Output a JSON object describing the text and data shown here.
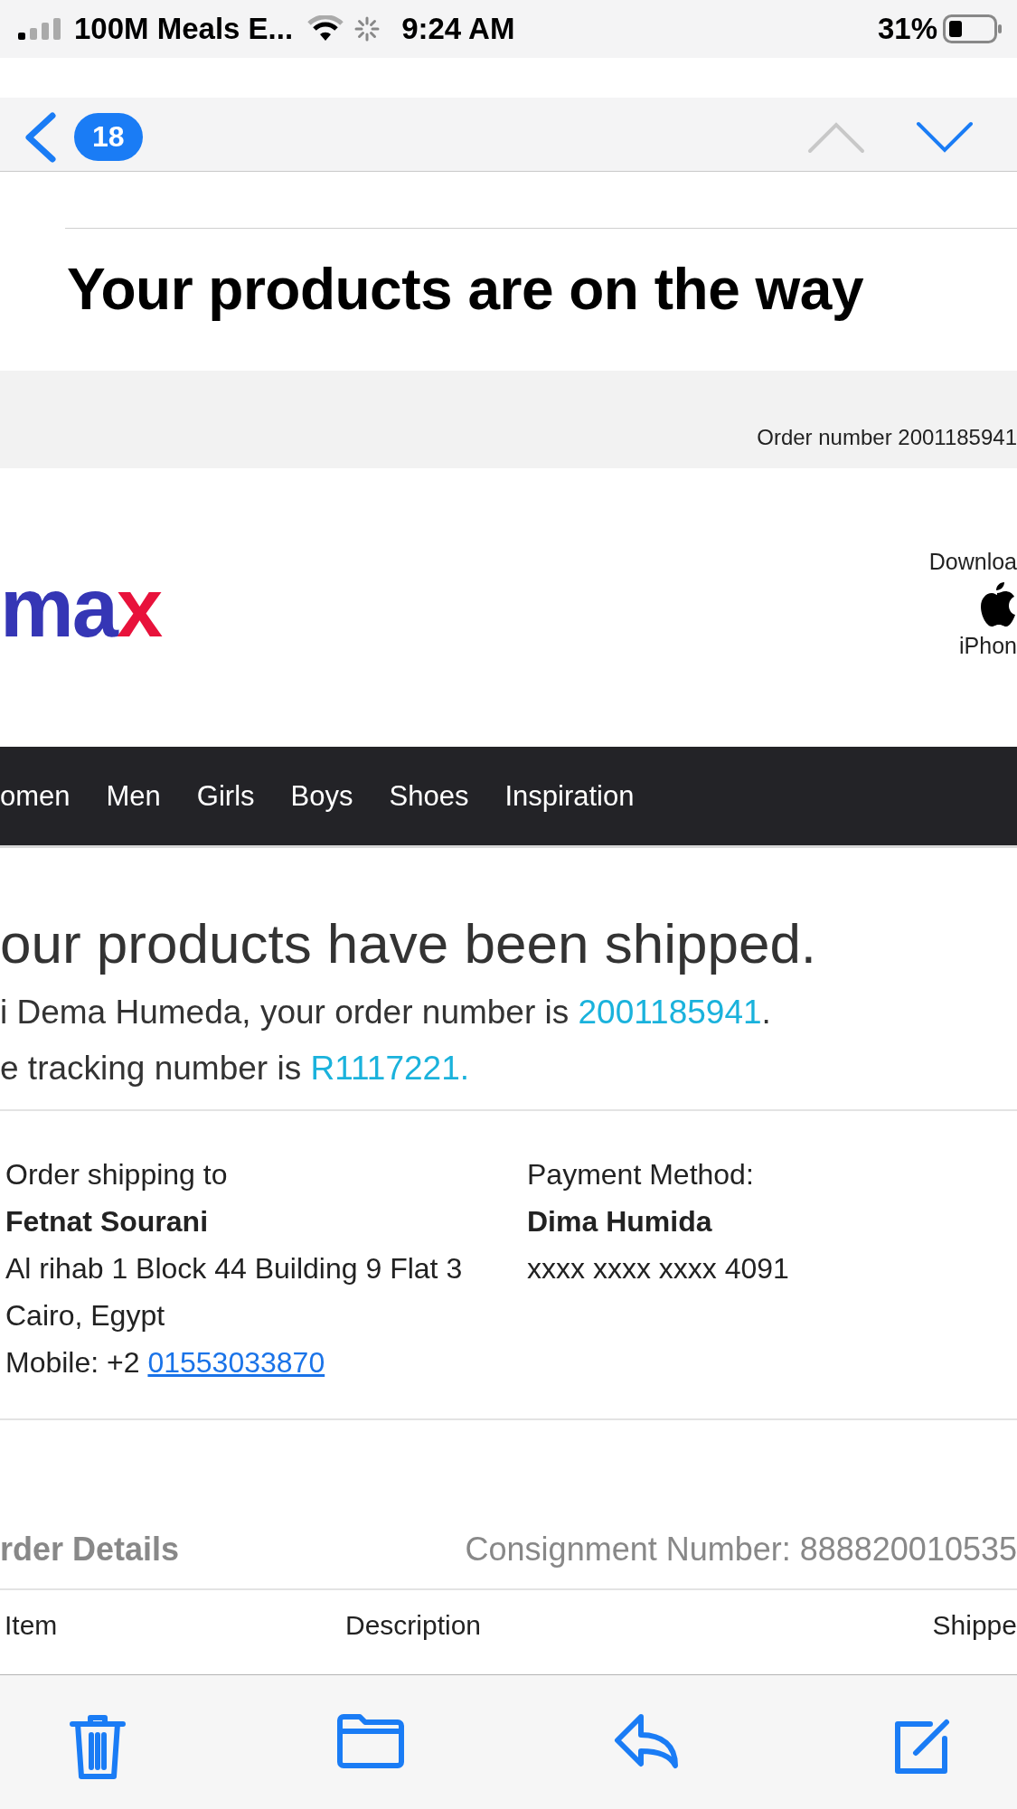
{
  "status_bar": {
    "carrier": "100M Meals E...",
    "time": "9:24 AM",
    "battery": "31%"
  },
  "nav": {
    "unread_count": "18",
    "up_disabled": true,
    "down_disabled": false
  },
  "subject": "Your products are on the way",
  "email": {
    "order_bar": "Order number 2001185941",
    "logo": {
      "part_1": "ma",
      "part_2": "x"
    },
    "app_download": {
      "label": "Downloa",
      "device": "iPhon"
    },
    "menu": [
      "omen",
      "Men",
      "Girls",
      "Boys",
      "Shoes",
      "Inspiration"
    ],
    "headline": "our products have been shipped.",
    "greeting": {
      "text": "i Dema Humeda, your order number is ",
      "order_link": "2001185941",
      "end": "."
    },
    "tracking": {
      "text": "e tracking number is ",
      "link": "R1117221."
    },
    "shipping": {
      "label": "Order shipping to",
      "name": "Fetnat Sourani",
      "address_lines": [
        "Al rihab 1 Block 44 Building 9 Flat 3",
        "Cairo, Egypt"
      ],
      "mobile_label": "Mobile: +2 ",
      "mobile_link": "01553033870"
    },
    "payment": {
      "label": "Payment Method:",
      "name": "Dima Humida",
      "card": "xxxx xxxx xxxx 4091"
    },
    "order_details": {
      "title": "rder Details",
      "consignment": "Consignment Number: 888820010535"
    },
    "table_columns": [
      "Item",
      "Description",
      "Shippe"
    ]
  }
}
